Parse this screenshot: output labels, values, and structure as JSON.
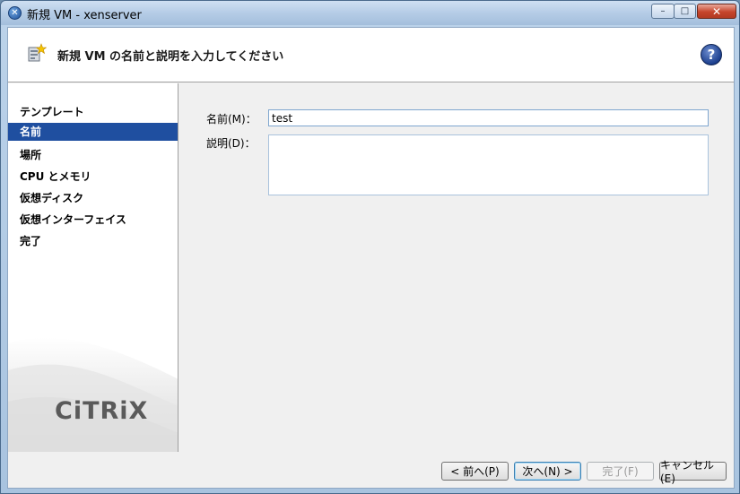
{
  "window": {
    "title": "新規 VM - xenserver",
    "controls": {
      "minimize": "–",
      "maximize": "□",
      "close": "✕"
    }
  },
  "header": {
    "title": "新規 VM の名前と説明を入力してください",
    "help": "?"
  },
  "sidebar": {
    "steps": [
      {
        "label": "テンプレート",
        "active": false
      },
      {
        "label": "名前",
        "active": true
      },
      {
        "label": "場所",
        "active": false
      },
      {
        "label": "CPU とメモリ",
        "active": false
      },
      {
        "label": "仮想ディスク",
        "active": false
      },
      {
        "label": "仮想インターフェイス",
        "active": false
      },
      {
        "label": "完了",
        "active": false
      }
    ],
    "logo": "CiTRiX"
  },
  "form": {
    "name_label": "名前(M)：",
    "name_value": "test",
    "description_label": "説明(D)：",
    "description_value": ""
  },
  "footer": {
    "back": "< 前へ(P)",
    "next": "次へ(N) >",
    "finish": "完了(F)",
    "cancel": "キャンセル(E)"
  },
  "colors": {
    "selected_step": "#1f4fa0",
    "help_icon": "#1c3f8e",
    "close_button": "#c6452c"
  }
}
